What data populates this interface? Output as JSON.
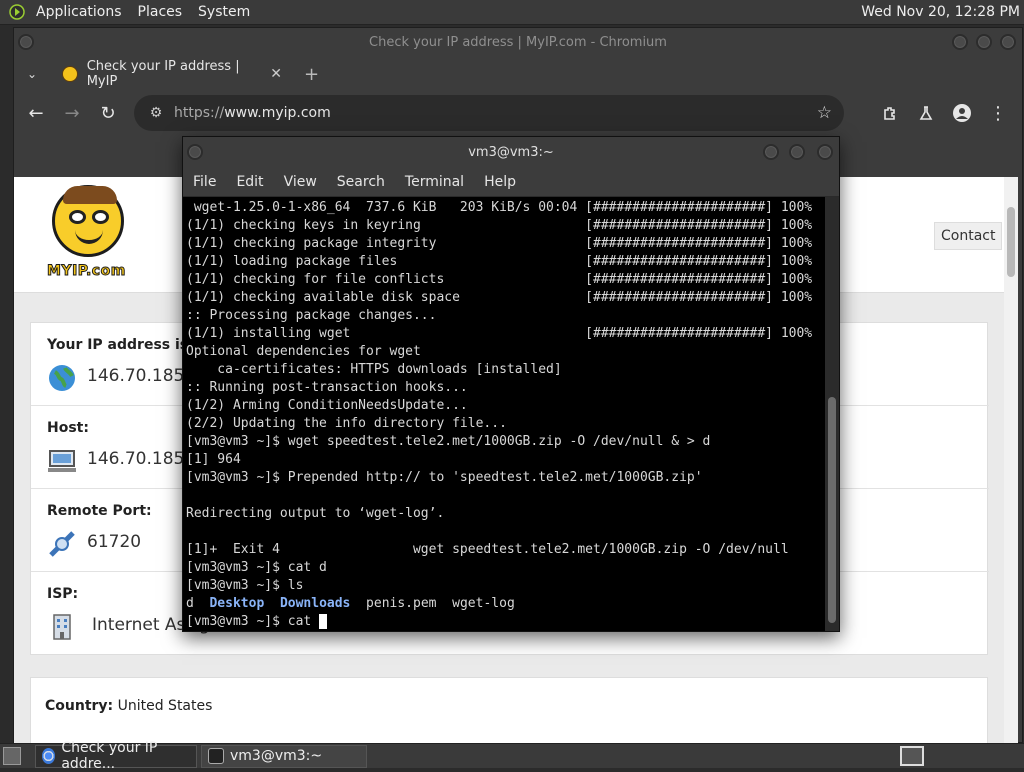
{
  "top_panel": {
    "menus": [
      "Applications",
      "Places",
      "System"
    ],
    "clock": "Wed Nov 20, 12:28 PM"
  },
  "browser": {
    "window_title": "Check your IP address | MyIP.com - Chromium",
    "tab_title": "Check your IP address | MyIP",
    "url_proto": "https://",
    "url_host": "www.myip.com"
  },
  "site": {
    "logo_text": "MYIP.com",
    "contact_label": "Contact",
    "rows": [
      {
        "label": "Your IP address is:",
        "value": "146.70.185.",
        "icon": "globe-icon"
      },
      {
        "label": "Host:",
        "value": "146.70.185.",
        "icon": "computer-icon"
      },
      {
        "label": "Remote Port:",
        "value": "61720",
        "icon": "cable-icon"
      },
      {
        "label": "ISP:",
        "value": "Internet Assig",
        "icon": "building-icon"
      }
    ],
    "country_label": "Country:",
    "country_value": "United States"
  },
  "terminal": {
    "title": "vm3@vm3:~",
    "menus": [
      "File",
      "Edit",
      "View",
      "Search",
      "Terminal",
      "Help"
    ],
    "lines": [
      " wget-1.25.0-1-x86_64  737.6 KiB   203 KiB/s 00:04 [######################] 100%",
      "(1/1) checking keys in keyring                     [######################] 100%",
      "(1/1) checking package integrity                   [######################] 100%",
      "(1/1) loading package files                        [######################] 100%",
      "(1/1) checking for file conflicts                  [######################] 100%",
      "(1/1) checking available disk space                [######################] 100%",
      ":: Processing package changes...",
      "(1/1) installing wget                              [######################] 100%",
      "Optional dependencies for wget",
      "    ca-certificates: HTTPS downloads [installed]",
      ":: Running post-transaction hooks...",
      "(1/2) Arming ConditionNeedsUpdate...",
      "(2/2) Updating the info directory file...",
      "[vm3@vm3 ~]$ wget speedtest.tele2.met/1000GB.zip -O /dev/null & > d",
      "[1] 964",
      "[vm3@vm3 ~]$ Prepended http:// to 'speedtest.tele2.met/1000GB.zip'",
      "",
      "Redirecting output to ‘wget-log’.",
      "",
      "[1]+  Exit 4                 wget speedtest.tele2.met/1000GB.zip -O /dev/null",
      "[vm3@vm3 ~]$ cat d",
      "[vm3@vm3 ~]$ ls"
    ],
    "ls_output": {
      "plain1": "d",
      "dir1": "Desktop",
      "dir2": "Downloads",
      "plain2": "penis.pem",
      "plain3": "wget-log"
    },
    "prompt_line": "[vm3@vm3 ~]$ cat "
  },
  "taskbar": {
    "tasks": [
      "Check your IP addre...",
      "vm3@vm3:~"
    ]
  }
}
